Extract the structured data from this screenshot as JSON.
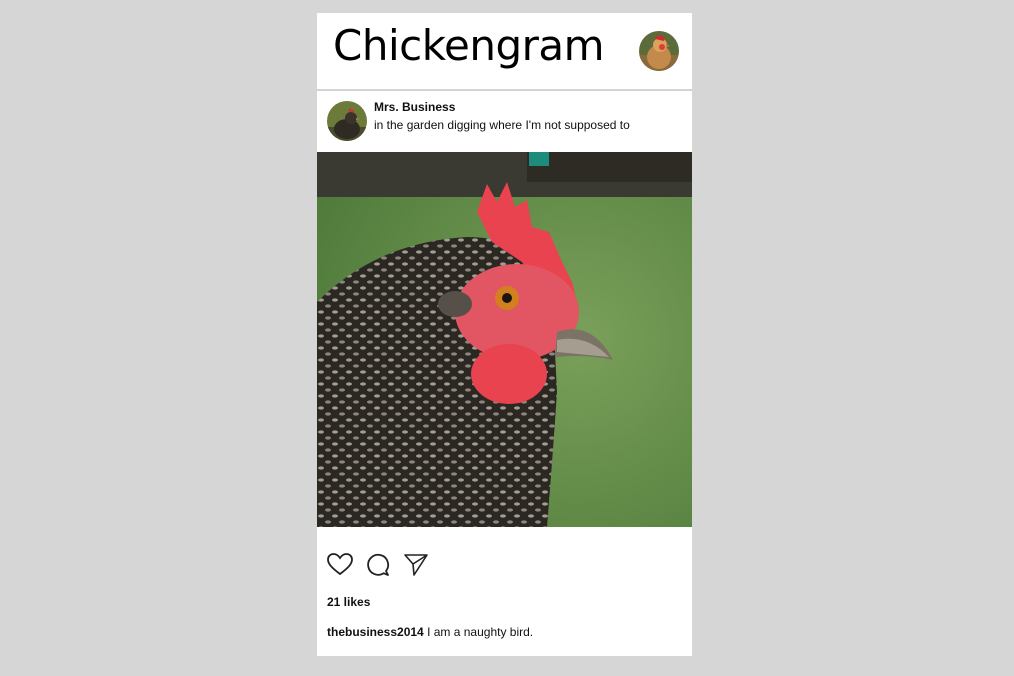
{
  "app": {
    "title": "Chickengram"
  },
  "header": {
    "profile_icon": "chicken-avatar-icon"
  },
  "post": {
    "author": "Mrs. Business",
    "caption": "in the garden digging where I'm not supposed to",
    "likes_text": "21 likes",
    "comment": {
      "username": "thebusiness2014",
      "text": "I am a naughty bird."
    },
    "actions": [
      "heart-icon",
      "comment-icon",
      "share-icon"
    ]
  },
  "colors": {
    "background": "#d6d6d6",
    "card": "#ffffff",
    "divider": "#d3d3d3",
    "comb_red": "#e8434f"
  }
}
